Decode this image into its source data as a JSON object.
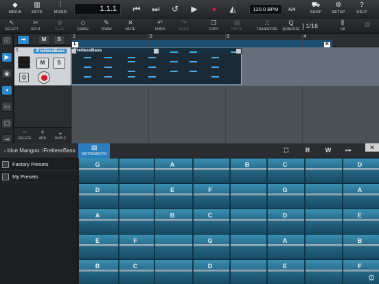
{
  "top_toolbar": {
    "media": "MEDIA",
    "keys": "KEYS",
    "mixer": "MIXER",
    "position": "1.1.1",
    "tempo": "120.0 BPM",
    "time_signature": "4/4",
    "shop": "SHOP",
    "setup": "SETUP",
    "help": "HELP"
  },
  "edit_toolbar": {
    "select": "SELECT",
    "split": "SPLIT",
    "glue": "GLUE",
    "erase": "ERASE",
    "draw": "DRAW",
    "mute": "MUTE",
    "undo": "UNDO",
    "redo": "REDO",
    "copy": "COPY",
    "paste": "PASTE",
    "transpose": "TRANSPOSE",
    "quantize": "QUANTIZE",
    "quantize_value": "1/16",
    "grid": "1/8"
  },
  "track_header": {
    "m": "M",
    "s": "S",
    "track_number": "1",
    "track_name": "iFretlessBass",
    "mute": "M",
    "solo": "S",
    "delete": "DELETE",
    "add": "ADD",
    "duplicate": "DUPLC"
  },
  "ruler": {
    "bars": [
      "1",
      "2",
      "3",
      "4"
    ],
    "left_locator": "L",
    "right_locator": "R"
  },
  "region": {
    "name": "iFretlessBass"
  },
  "bottom_panel": {
    "title": "blue Mangoo: iFretlessBass",
    "instruments_tab": "INSTRUMENTS",
    "r": "R",
    "w": "W",
    "presets": [
      "Factory Presets",
      "My Presets"
    ]
  },
  "fretboard": {
    "strings": [
      [
        "G",
        "A",
        "B",
        "C",
        "D"
      ],
      [
        "D",
        "E",
        "F",
        "G",
        "A"
      ],
      [
        "A",
        "B",
        "C",
        "D",
        "E"
      ],
      [
        "E",
        "F",
        "G",
        "A",
        "B"
      ],
      [
        "B",
        "C",
        "D",
        "E",
        "F"
      ]
    ]
  }
}
